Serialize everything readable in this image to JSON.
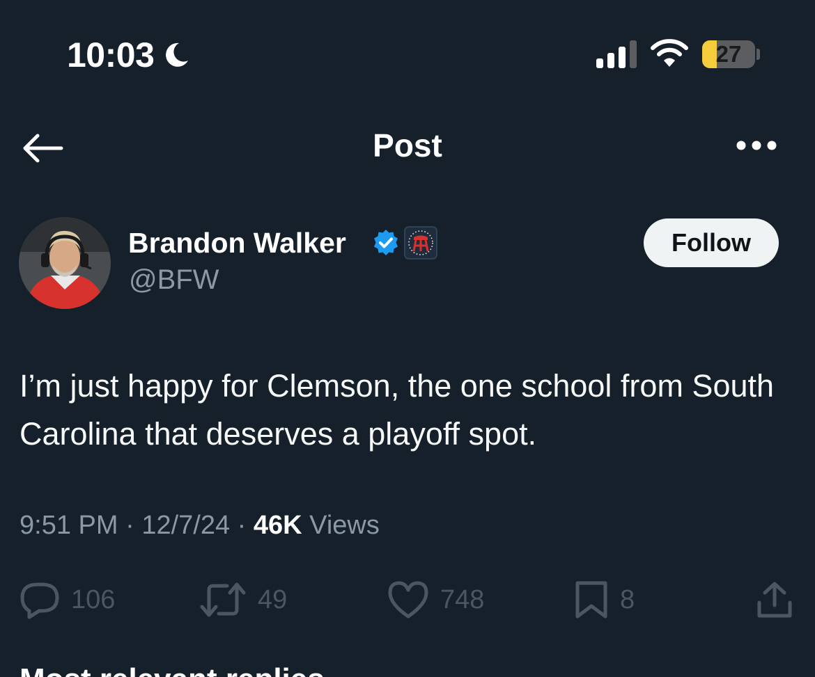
{
  "status_bar": {
    "time": "10:03",
    "battery_level": "27",
    "battery_fraction": 0.27,
    "focus_icon": "moon-icon"
  },
  "header": {
    "title": "Post",
    "back_icon": "back-arrow-icon",
    "more_icon": "more-options-icon"
  },
  "author": {
    "display_name": "Brandon Walker",
    "handle": "@BFW",
    "verified": true,
    "verified_color": "#1d9bf0",
    "follow_label": "Follow"
  },
  "post": {
    "text": "I’m just happy for Clemson, the one school from South Carolina that deserves a playoff spot.",
    "time": "9:51 PM",
    "date": "12/7/24",
    "views_count": "46K",
    "views_label": "Views"
  },
  "actions": {
    "replies": "106",
    "reposts": "49",
    "likes": "748",
    "bookmarks": "8"
  },
  "colors": {
    "background": "#15202b",
    "muted_text": "#8b98a5",
    "action_icons": "#4a5763",
    "battery_fill": "#f5cc3b"
  },
  "next_section": {
    "title": "Most relevant replies"
  }
}
